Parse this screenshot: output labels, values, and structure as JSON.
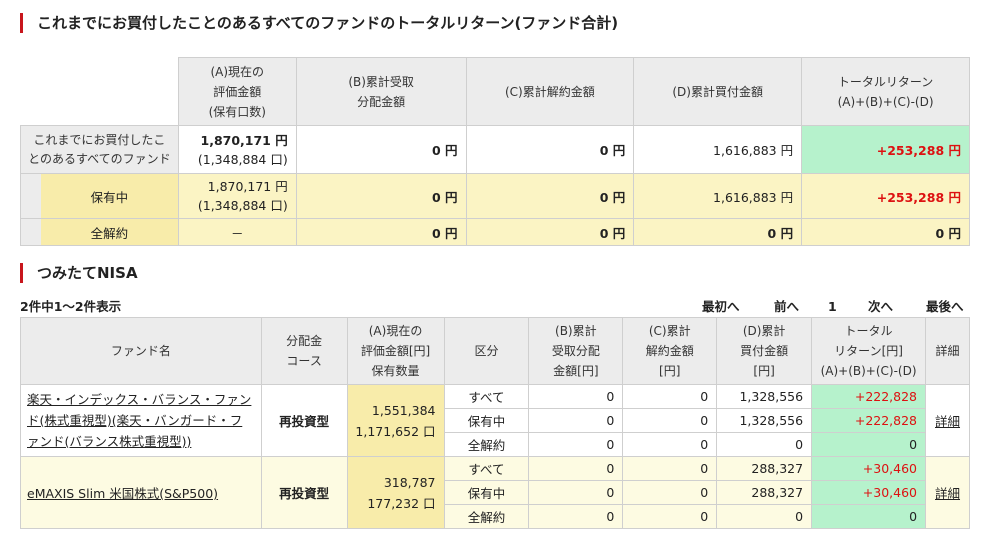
{
  "summary": {
    "title": "これまでにお買付したことのあるすべてのファンドのトータルリターン(ファンド合計)",
    "headers": {
      "a": [
        "(A)現在の",
        "評価金額",
        "(保有口数)"
      ],
      "b": [
        "(B)累計受取",
        "分配金額"
      ],
      "c": "(C)累計解約金額",
      "d": "(D)累計買付金額",
      "e": [
        "トータルリターン",
        "(A)+(B)+(C)-(D)"
      ]
    },
    "rows": [
      {
        "label": [
          "これまでにお買付したこ",
          "とのあるすべてのファンド"
        ],
        "a": "1,870,171 円",
        "a_units": "(1,348,884 口)",
        "b": "0 円",
        "c": "0 円",
        "d": "1,616,883 円",
        "e": "+253,288 円"
      },
      {
        "label": [
          "保有中"
        ],
        "a": "1,870,171 円",
        "a_units": "(1,348,884 口)",
        "b": "0 円",
        "c": "0 円",
        "d": "1,616,883 円",
        "e": "+253,288 円"
      },
      {
        "label": [
          "全解約"
        ],
        "a": "－",
        "a_units": "",
        "b": "0 円",
        "c": "0 円",
        "d": "0 円",
        "e": "0 円"
      }
    ]
  },
  "nisa": {
    "title": "つみたてNISA",
    "count_text": "2件中1～2件表示",
    "pager": {
      "first": "最初へ",
      "prev": "前へ",
      "page": "1",
      "next": "次へ",
      "last": "最後へ"
    },
    "headers": {
      "fund": "ファンド名",
      "course": [
        "分配金",
        "コース"
      ],
      "a": [
        "(A)現在の",
        "評価金額[円]",
        "保有数量"
      ],
      "kubun": "区分",
      "b": [
        "(B)累計",
        "受取分配",
        "金額[円]"
      ],
      "c": [
        "(C)累計",
        "解約金額",
        "[円]"
      ],
      "d": [
        "(D)累計",
        "買付金額",
        "[円]"
      ],
      "e": [
        "トータル",
        "リターン[円]",
        "(A)+(B)+(C)-(D)"
      ],
      "detail": "詳細"
    },
    "funds": [
      {
        "name": "楽天・インデックス・バランス・ファンド(株式重視型)(楽天・バンガード・ファンド(バランス株式重視型))",
        "course": "再投資型",
        "value": "1,551,384",
        "units": "1,171,652 口",
        "detail": "詳細",
        "rows": [
          {
            "kubun": "すべて",
            "b": "0",
            "c": "0",
            "d": "1,328,556",
            "e": "+222,828"
          },
          {
            "kubun": "保有中",
            "b": "0",
            "c": "0",
            "d": "1,328,556",
            "e": "+222,828"
          },
          {
            "kubun": "全解約",
            "b": "0",
            "c": "0",
            "d": "0",
            "e": "0"
          }
        ]
      },
      {
        "name": "eMAXIS Slim 米国株式(S&P500)",
        "course": "再投資型",
        "value": "318,787",
        "units": "177,232 口",
        "detail": "詳細",
        "rows": [
          {
            "kubun": "すべて",
            "b": "0",
            "c": "0",
            "d": "288,327",
            "e": "+30,460"
          },
          {
            "kubun": "保有中",
            "b": "0",
            "c": "0",
            "d": "288,327",
            "e": "+30,460"
          },
          {
            "kubun": "全解約",
            "b": "0",
            "c": "0",
            "d": "0",
            "e": "0"
          }
        ]
      }
    ]
  },
  "colors": {
    "accent": "#c8161d",
    "return_bg": "#b6f2cc",
    "held_bg": "#fbf4c4",
    "gain_text": "#dd1111"
  }
}
